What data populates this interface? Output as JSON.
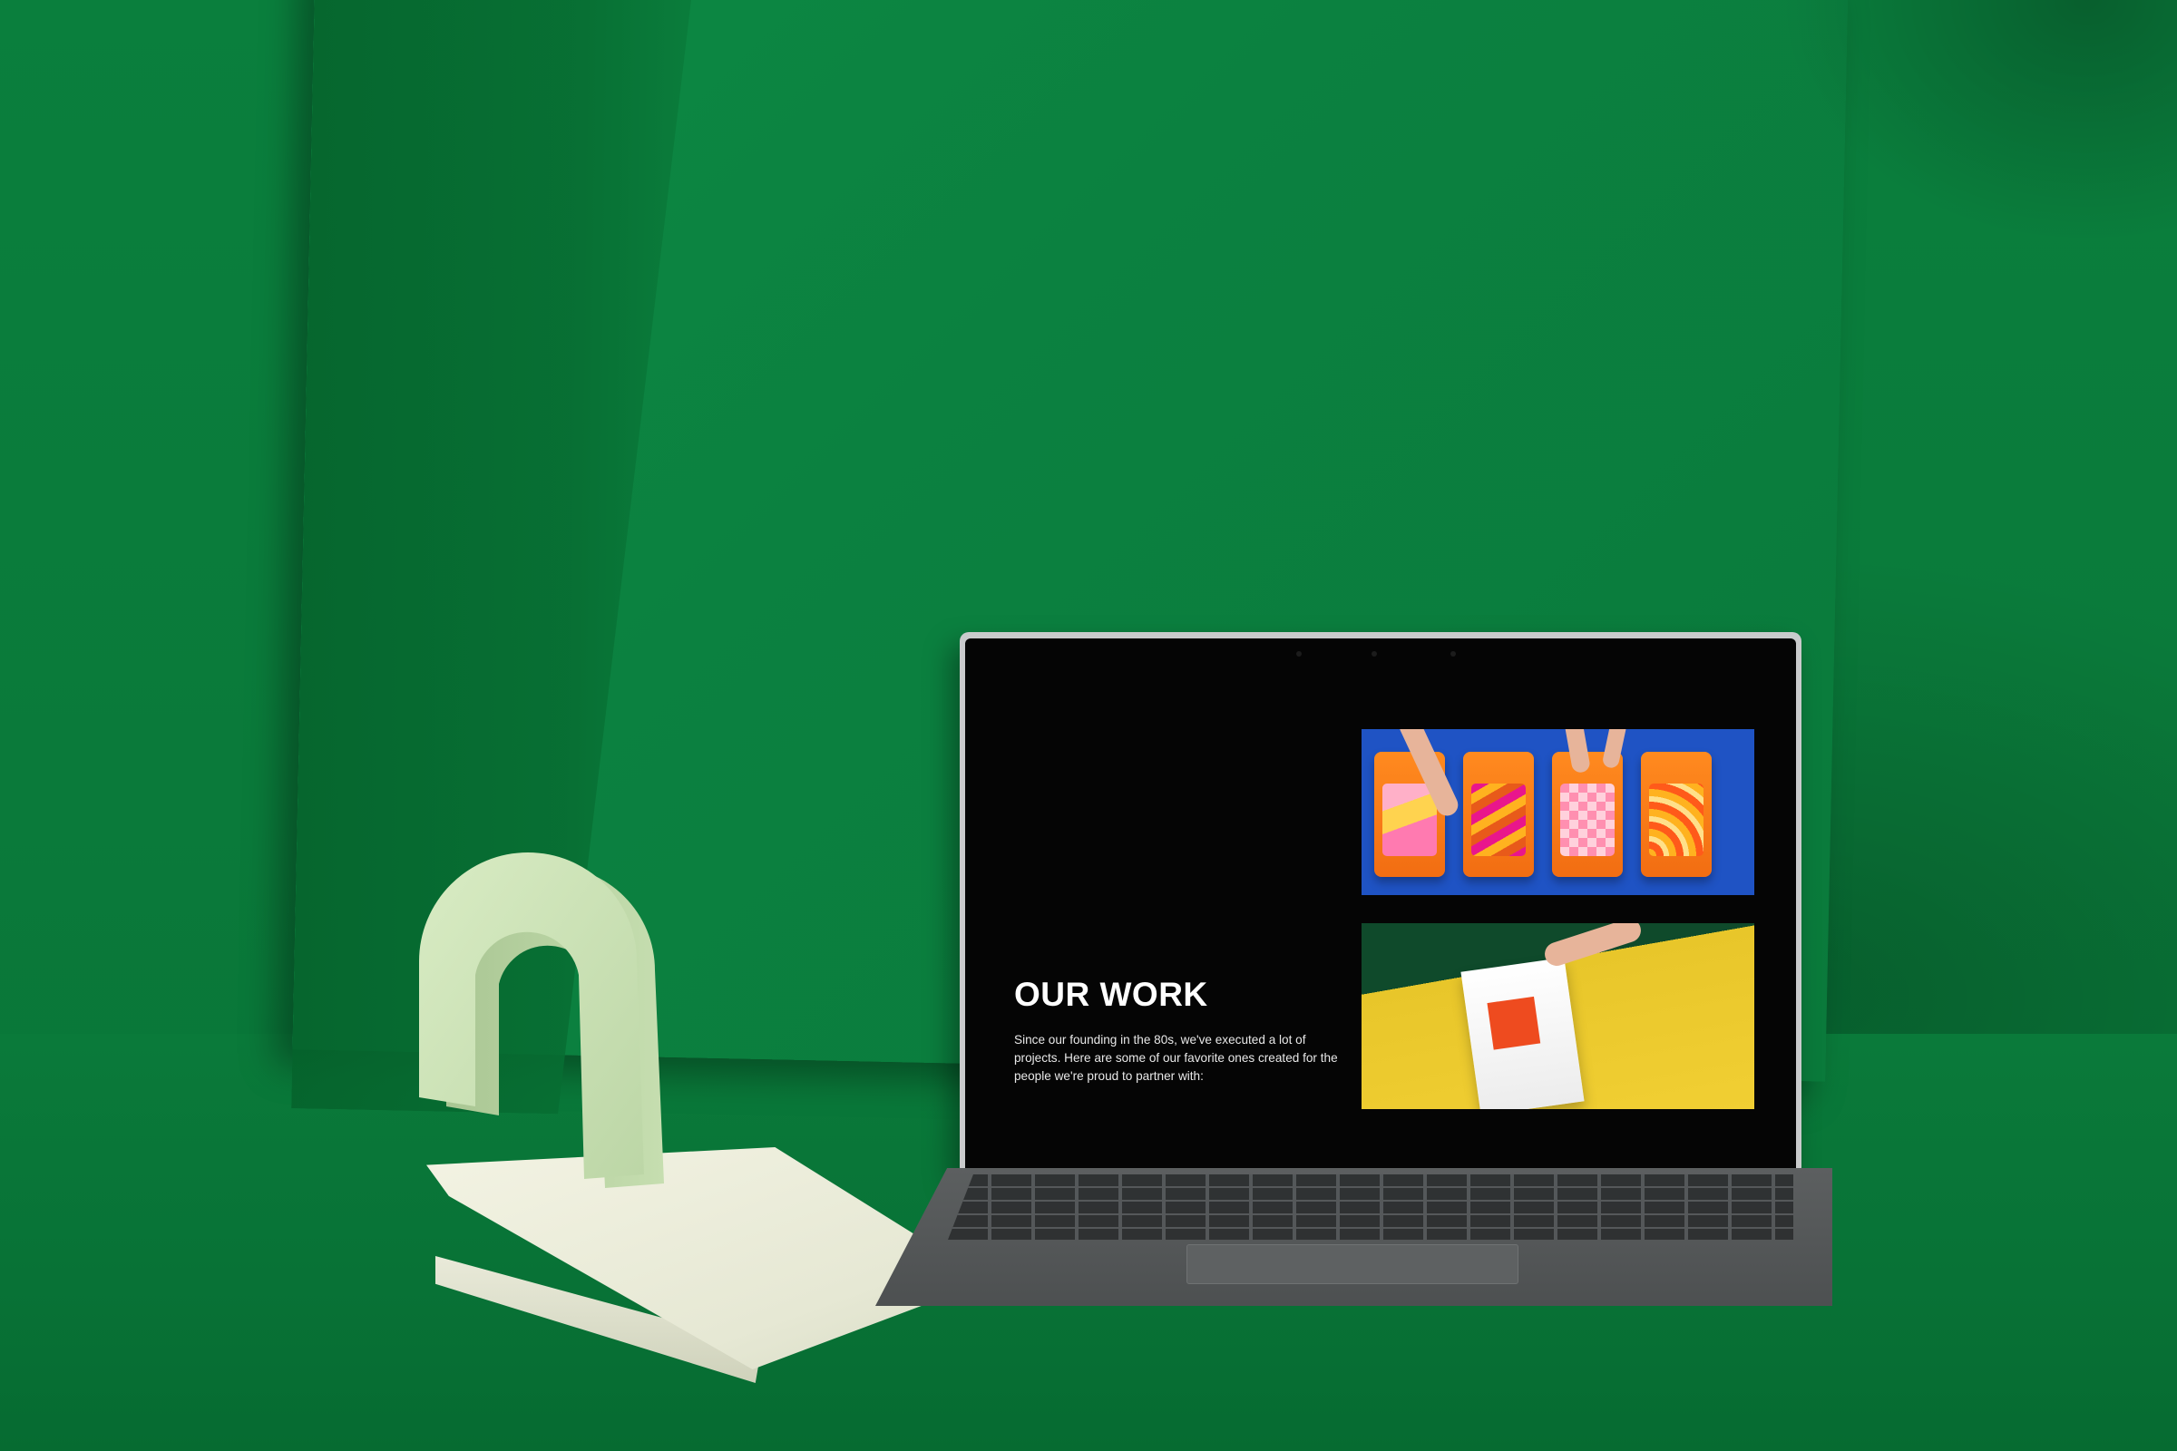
{
  "screen": {
    "title": "OUR WORK",
    "description": "Since our founding in the 80s, we've executed a lot of projects. Here are some of our favorite ones created for the people we're proud to partner with:",
    "vertical_word": "WORK"
  },
  "colors": {
    "background_green": "#0a7d3b",
    "screen_black": "#050505",
    "arch_mint": "#d4e8bf",
    "notebook_cream": "#eef0de",
    "tray_orange": "#f37a18",
    "tray_background_blue": "#1f53c4",
    "bag_background_yellow": "#f1cf33",
    "keyboard_grey": "#545758"
  }
}
